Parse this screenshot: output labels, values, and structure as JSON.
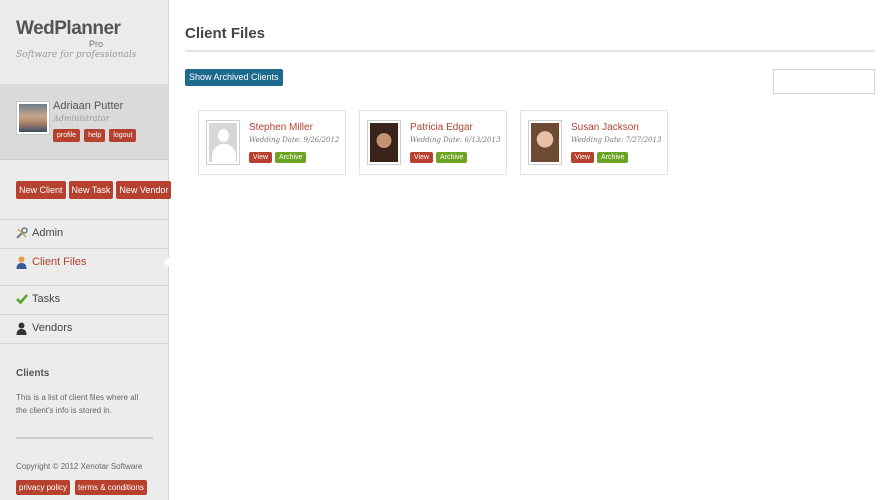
{
  "brand": {
    "name": "WedPlanner",
    "suffix": "Pro",
    "tagline": "Software for professionals"
  },
  "user": {
    "name": "Adriaan Putter",
    "role": "Administrator",
    "links": [
      "profile",
      "help",
      "logout"
    ]
  },
  "actions": {
    "new_client": "New Client",
    "new_task": "New Task",
    "new_vendor": "New Vendor"
  },
  "nav": [
    {
      "label": "Admin",
      "icon": "tools-icon"
    },
    {
      "label": "Client Files",
      "icon": "person-icon",
      "active": true
    },
    {
      "label": "Tasks",
      "icon": "check-icon"
    },
    {
      "label": "Vendors",
      "icon": "user-icon"
    }
  ],
  "about": {
    "title": "Clients",
    "text": "This is a list of client files where all the client's info is stored in."
  },
  "footer": {
    "copyright": "Copyright © 2012 Xenotar Software",
    "privacy": "privacy policy",
    "terms": "terms & conditions"
  },
  "main": {
    "title": "Client Files",
    "archived_button": "Show Archived Clients",
    "search_value": ""
  },
  "clients": [
    {
      "name": "Stephen Miller",
      "date": "Wedding Date: 9/26/2012",
      "view": "View",
      "archive": "Archive"
    },
    {
      "name": "Patricia Edgar",
      "date": "Wedding Date: 6/13/2013",
      "view": "View",
      "archive": "Archive"
    },
    {
      "name": "Susan Jackson",
      "date": "Wedding Date: 7/27/2013",
      "view": "View",
      "archive": "Archive"
    }
  ],
  "colors": {
    "accent": "#b5412e",
    "green": "#6ea425",
    "blue": "#1e6a8c"
  }
}
